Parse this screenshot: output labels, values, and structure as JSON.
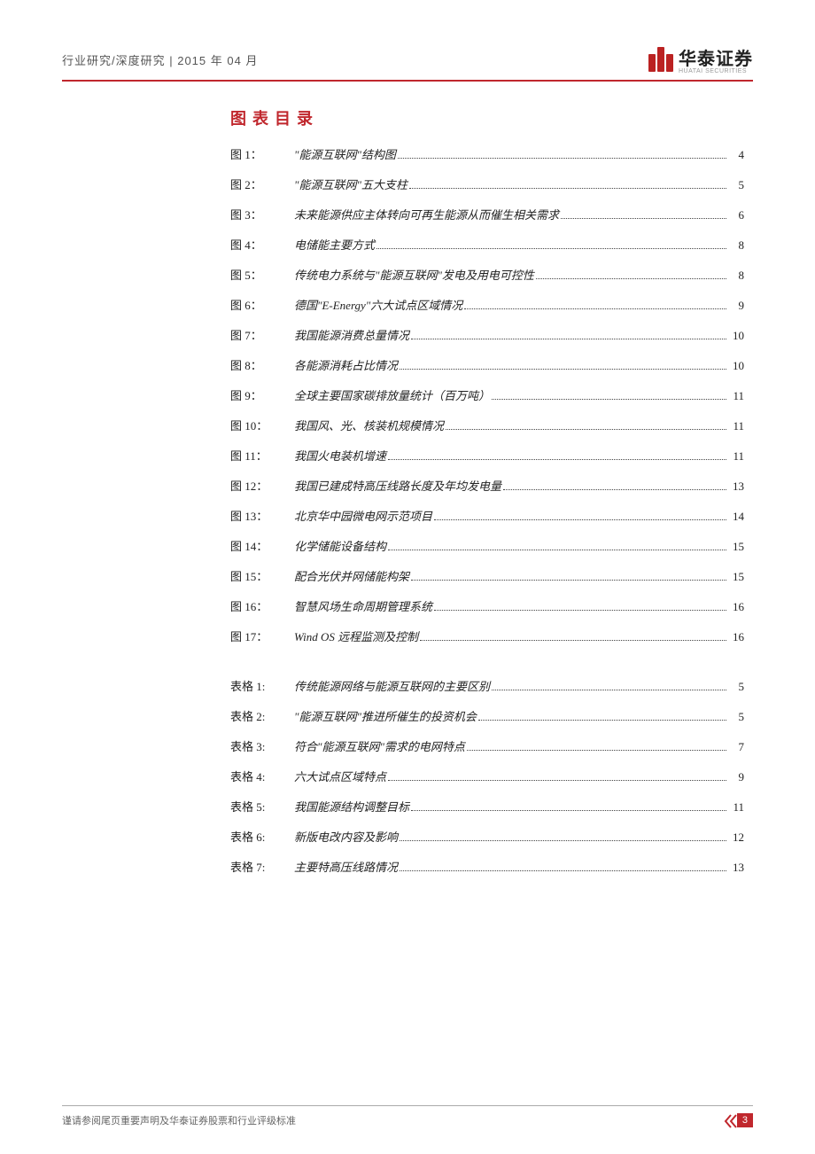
{
  "header": {
    "breadcrumb": "行业研究/深度研究 | 2015 年 04 月",
    "brand": "华泰证券",
    "brand_sub": "HUATAI SECURITIES"
  },
  "section_title": "图表目录",
  "figures": [
    {
      "label": "图 1：",
      "title": "\"能源互联网\"结构图",
      "page": "4"
    },
    {
      "label": "图 2：",
      "title": "\"能源互联网\"五大支柱",
      "page": "5"
    },
    {
      "label": "图 3：",
      "title": "未来能源供应主体转向可再生能源从而催生相关需求",
      "page": "6"
    },
    {
      "label": "图 4：",
      "title": "电储能主要方式",
      "page": "8"
    },
    {
      "label": "图 5：",
      "title": "传统电力系统与\"能源互联网\"发电及用电可控性",
      "page": "8"
    },
    {
      "label": "图 6：",
      "title": "德国\"E-Energy\"六大试点区域情况",
      "page": "9"
    },
    {
      "label": "图 7：",
      "title": "我国能源消费总量情况",
      "page": "10"
    },
    {
      "label": "图 8：",
      "title": "各能源消耗占比情况",
      "page": "10"
    },
    {
      "label": "图 9：",
      "title": "全球主要国家碳排放量统计（百万吨）",
      "page": "11"
    },
    {
      "label": "图 10：",
      "title": "我国风、光、核装机规模情况",
      "page": "11"
    },
    {
      "label": "图 11：",
      "title": "我国火电装机增速",
      "page": "11"
    },
    {
      "label": "图 12：",
      "title": "我国已建成特高压线路长度及年均发电量",
      "page": "13"
    },
    {
      "label": "图 13：",
      "title": "北京华中园微电网示范项目",
      "page": "14"
    },
    {
      "label": "图 14：",
      "title": "化学储能设备结构",
      "page": "15"
    },
    {
      "label": "图 15：",
      "title": "配合光伏并网储能构架",
      "page": "15"
    },
    {
      "label": "图 16：",
      "title": "智慧风场生命周期管理系统",
      "page": "16"
    },
    {
      "label": "图 17：",
      "title": "Wind OS 远程监测及控制",
      "page": "16"
    }
  ],
  "tables": [
    {
      "label": "表格 1:",
      "title": "传统能源网络与能源互联网的主要区别",
      "page": "5"
    },
    {
      "label": "表格 2:",
      "title": "\"能源互联网\"推进所催生的投资机会",
      "page": "5"
    },
    {
      "label": "表格 3:",
      "title": "符合\"能源互联网\"需求的电网特点",
      "page": "7"
    },
    {
      "label": "表格 4:",
      "title": "六大试点区域特点",
      "page": "9"
    },
    {
      "label": "表格 5:",
      "title": "我国能源结构调整目标",
      "page": "11"
    },
    {
      "label": "表格 6:",
      "title": "新版电改内容及影响",
      "page": "12"
    },
    {
      "label": "表格 7:",
      "title": "主要特高压线路情况",
      "page": "13"
    }
  ],
  "footer": {
    "disclaimer": "谨请参阅尾页重要声明及华泰证券股票和行业评级标准",
    "page_number": "3"
  }
}
